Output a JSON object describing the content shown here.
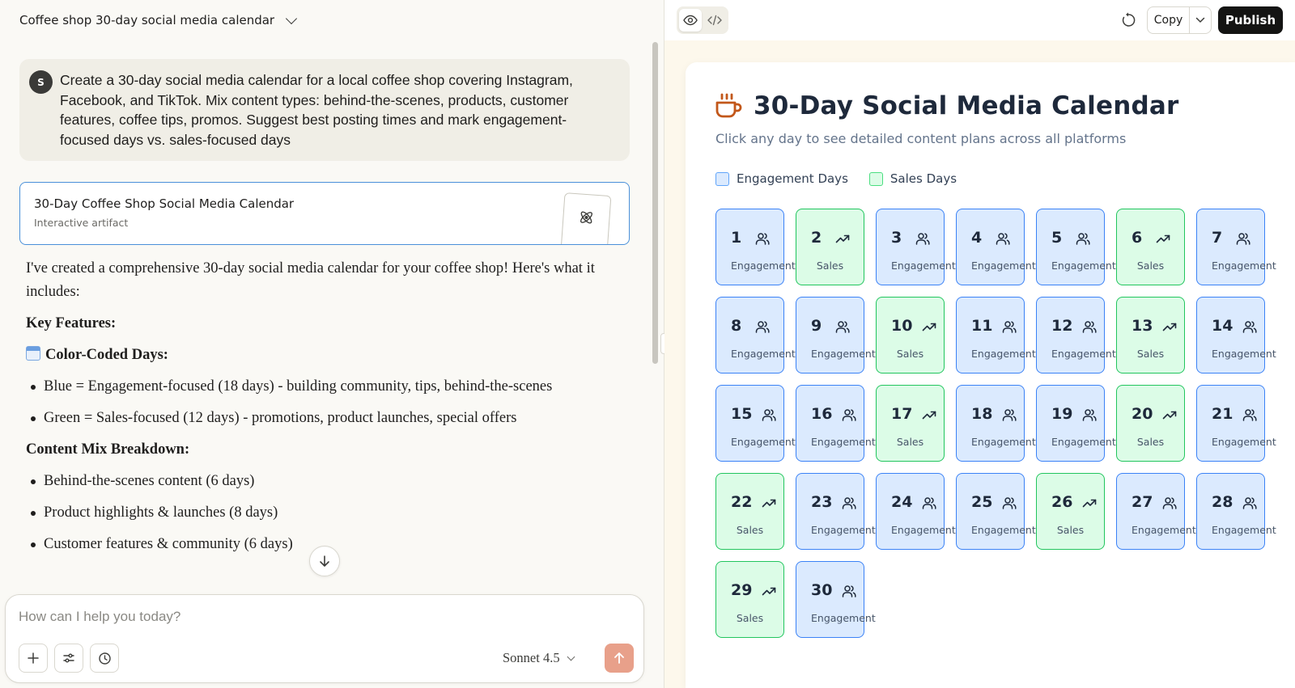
{
  "chat": {
    "title": "Coffee shop 30-day social media calendar",
    "user_avatar": "S",
    "user_message": "Create a 30-day social media calendar for a local coffee shop covering Instagram, Facebook, and TikTok. Mix content types: behind-the-scenes, products, customer features, coffee tips, promos. Suggest best posting times and mark engagement-focused days vs. sales-focused days",
    "artifact_card": {
      "title": "30-Day Coffee Shop Social Media Calendar",
      "subtitle": "Interactive artifact"
    },
    "response": {
      "intro": "I've created a comprehensive 30-day social media calendar for your coffee shop! Here's what it includes:",
      "key_features": "Key Features:",
      "color_coded": "Color-Coded Days:",
      "color_items": [
        "Blue = Engagement-focused (18 days) - building community, tips, behind-the-scenes",
        "Green = Sales-focused (12 days) - promotions, product launches, special offers"
      ],
      "content_mix": "Content Mix Breakdown:",
      "mix_items": [
        "Behind-the-scenes content (6 days)",
        "Product highlights & launches (8 days)",
        "Customer features & community (6 days)"
      ]
    },
    "input_placeholder": "How can I help you today?",
    "model": "Sonnet 4.5"
  },
  "toolbar": {
    "copy_label": "Copy",
    "publish_label": "Publish"
  },
  "calendar": {
    "title": "30-Day Social Media Calendar",
    "subtitle": "Click any day to see detailed content plans across all platforms",
    "legend": {
      "engagement": "Engagement Days",
      "sales": "Sales Days"
    },
    "colors": {
      "engagement_bg": "#dbeafe",
      "engagement_border": "#3b82f6",
      "sales_bg": "#dcfce7",
      "sales_border": "#22c55e"
    },
    "days": [
      {
        "day": 1,
        "type": "Engagement"
      },
      {
        "day": 2,
        "type": "Sales"
      },
      {
        "day": 3,
        "type": "Engagement"
      },
      {
        "day": 4,
        "type": "Engagement"
      },
      {
        "day": 5,
        "type": "Engagement"
      },
      {
        "day": 6,
        "type": "Sales"
      },
      {
        "day": 7,
        "type": "Engagement"
      },
      {
        "day": 8,
        "type": "Engagement"
      },
      {
        "day": 9,
        "type": "Engagement"
      },
      {
        "day": 10,
        "type": "Sales"
      },
      {
        "day": 11,
        "type": "Engagement"
      },
      {
        "day": 12,
        "type": "Engagement"
      },
      {
        "day": 13,
        "type": "Sales"
      },
      {
        "day": 14,
        "type": "Engagement"
      },
      {
        "day": 15,
        "type": "Engagement"
      },
      {
        "day": 16,
        "type": "Engagement"
      },
      {
        "day": 17,
        "type": "Sales"
      },
      {
        "day": 18,
        "type": "Engagement"
      },
      {
        "day": 19,
        "type": "Engagement"
      },
      {
        "day": 20,
        "type": "Sales"
      },
      {
        "day": 21,
        "type": "Engagement"
      },
      {
        "day": 22,
        "type": "Sales"
      },
      {
        "day": 23,
        "type": "Engagement"
      },
      {
        "day": 24,
        "type": "Engagement"
      },
      {
        "day": 25,
        "type": "Engagement"
      },
      {
        "day": 26,
        "type": "Sales"
      },
      {
        "day": 27,
        "type": "Engagement"
      },
      {
        "day": 28,
        "type": "Engagement"
      },
      {
        "day": 29,
        "type": "Sales"
      },
      {
        "day": 30,
        "type": "Engagement"
      }
    ]
  }
}
